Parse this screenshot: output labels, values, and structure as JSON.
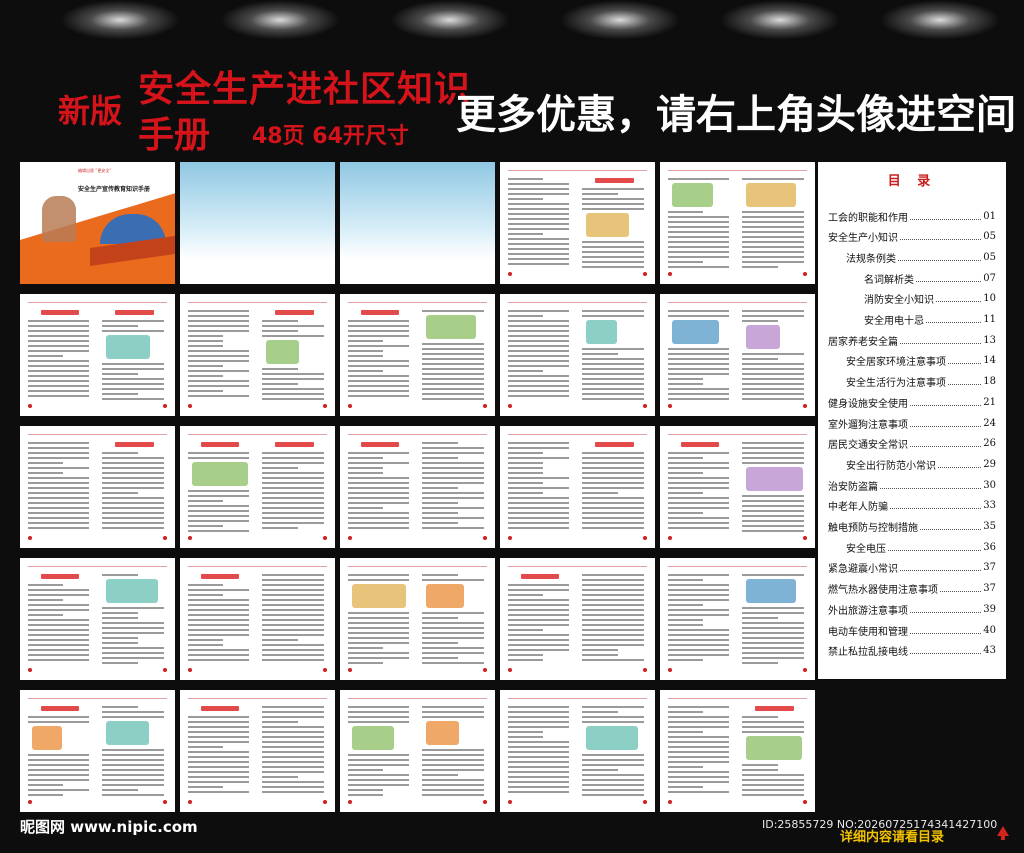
{
  "header": {
    "edition": "新版",
    "title_line1": "安全生产进社区知识",
    "title_line2": "手册",
    "spec": "48页 64开尺寸",
    "promo": "更多优惠，请右上角头像进空间"
  },
  "cover": {
    "top_small": "编辑出版 “更安全”",
    "title": "安全生产宣传教育知识手册"
  },
  "toc": {
    "title": "目 录",
    "entries": [
      {
        "label": "工会的职能和作用",
        "page": "01",
        "indent": 0
      },
      {
        "label": "安全生产小知识",
        "page": "05",
        "indent": 0
      },
      {
        "label": "法规条例类",
        "page": "05",
        "indent": 1
      },
      {
        "label": "名词解析类",
        "page": "07",
        "indent": 2
      },
      {
        "label": "消防安全小知识",
        "page": "10",
        "indent": 2
      },
      {
        "label": "安全用电十忌",
        "page": "11",
        "indent": 2
      },
      {
        "label": "居家养老安全篇",
        "page": "13",
        "indent": 0
      },
      {
        "label": "安全居家环境注意事项",
        "page": "14",
        "indent": 1
      },
      {
        "label": "安全生活行为注意事项",
        "page": "18",
        "indent": 1
      },
      {
        "label": "健身设施安全使用",
        "page": "21",
        "indent": 0
      },
      {
        "label": "室外遛狗注意事项",
        "page": "24",
        "indent": 0
      },
      {
        "label": "居民交通安全常识",
        "page": "26",
        "indent": 0
      },
      {
        "label": "安全出行防范小常识",
        "page": "29",
        "indent": 1
      },
      {
        "label": "治安防盗篇",
        "page": "30",
        "indent": 0
      },
      {
        "label": "中老年人防骗",
        "page": "33",
        "indent": 0
      },
      {
        "label": "触电预防与控制措施",
        "page": "35",
        "indent": 0
      },
      {
        "label": "安全电压",
        "page": "36",
        "indent": 1
      },
      {
        "label": "紧急避震小常识",
        "page": "37",
        "indent": 0
      },
      {
        "label": "燃气热水器使用注意事项",
        "page": "37",
        "indent": 0
      },
      {
        "label": "外出旅游注意事项",
        "page": "39",
        "indent": 0
      },
      {
        "label": "电动车使用和管理",
        "page": "40",
        "indent": 0
      },
      {
        "label": "禁止私拉乱接电线",
        "page": "43",
        "indent": 0
      }
    ]
  },
  "footer": {
    "site": "昵图网 www.nipic.com",
    "id_text": "ID:25855729 NO:20260725174341427100",
    "bottom_note": "详细内容请看目录"
  },
  "colors": {
    "background": "#0d0d0d",
    "title_red": "#d4141a",
    "cover_orange": "#ea6a1e",
    "toc_red": "#c81e1e",
    "note_yellow": "#f2c200"
  }
}
